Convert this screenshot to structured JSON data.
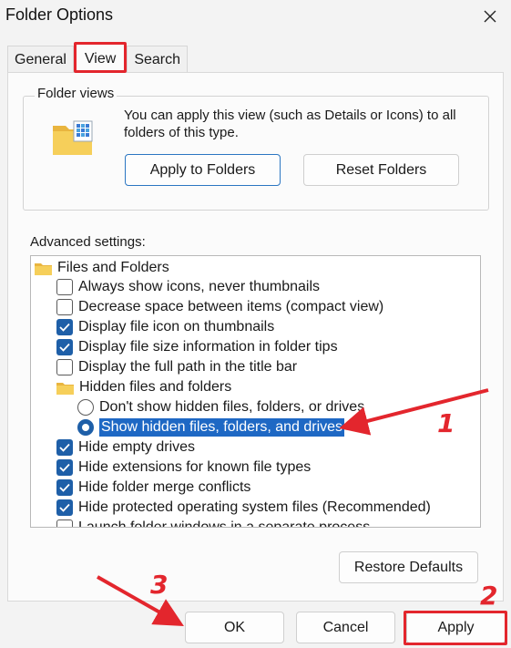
{
  "window": {
    "title": "Folder Options",
    "close_icon": "close-icon"
  },
  "tabs": [
    {
      "label": "General",
      "selected": false
    },
    {
      "label": "View",
      "selected": true
    },
    {
      "label": "Search",
      "selected": false
    }
  ],
  "folder_views": {
    "label": "Folder views",
    "icon": "folder-grid-icon",
    "description": "You can apply this view (such as Details or Icons) to all folders of this type.",
    "apply_button": "Apply to Folders",
    "reset_button": "Reset Folders"
  },
  "advanced": {
    "label": "Advanced settings:",
    "root": {
      "label": "Files and Folders",
      "icon": "folder-icon"
    },
    "items": [
      {
        "type": "checkbox",
        "label": "Always show icons, never thumbnails",
        "checked": false
      },
      {
        "type": "checkbox",
        "label": "Decrease space between items (compact view)",
        "checked": false
      },
      {
        "type": "checkbox",
        "label": "Display file icon on thumbnails",
        "checked": true
      },
      {
        "type": "checkbox",
        "label": "Display file size information in folder tips",
        "checked": true
      },
      {
        "type": "checkbox",
        "label": "Display the full path in the title bar",
        "checked": false
      },
      {
        "type": "folder",
        "label": "Hidden files and folders"
      },
      {
        "type": "radio",
        "label": "Don't show hidden files, folders, or drives",
        "checked": false
      },
      {
        "type": "radio",
        "label": "Show hidden files, folders, and drives",
        "checked": true,
        "selected": true
      },
      {
        "type": "checkbox",
        "label": "Hide empty drives",
        "checked": true
      },
      {
        "type": "checkbox",
        "label": "Hide extensions for known file types",
        "checked": true
      },
      {
        "type": "checkbox",
        "label": "Hide folder merge conflicts",
        "checked": true
      },
      {
        "type": "checkbox",
        "label": "Hide protected operating system files (Recommended)",
        "checked": true
      },
      {
        "type": "checkbox",
        "label": "Launch folder windows in a separate process",
        "checked": false
      }
    ],
    "restore_button": "Restore Defaults"
  },
  "footer": {
    "ok": "OK",
    "cancel": "Cancel",
    "apply": "Apply"
  },
  "annotations": {
    "step1": "1",
    "step2": "2",
    "step3": "3",
    "color": "#e3262d"
  }
}
